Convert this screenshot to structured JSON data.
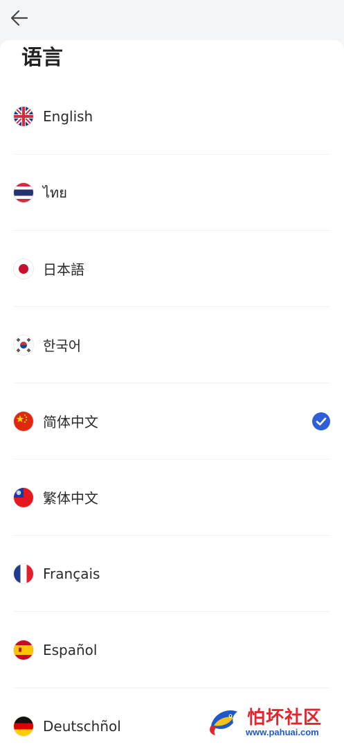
{
  "header": {
    "back_icon": "arrow-left-icon"
  },
  "page": {
    "title": "语言"
  },
  "languages": [
    {
      "label": "English",
      "flag": "uk-flag-icon",
      "selected": false
    },
    {
      "label": "ไทย",
      "flag": "thailand-flag-icon",
      "selected": false
    },
    {
      "label": "日本語",
      "flag": "japan-flag-icon",
      "selected": false
    },
    {
      "label": "한국어",
      "flag": "korea-flag-icon",
      "selected": false
    },
    {
      "label": "简体中文",
      "flag": "china-flag-icon",
      "selected": true
    },
    {
      "label": "繁体中文",
      "flag": "taiwan-flag-icon",
      "selected": false
    },
    {
      "label": "Français",
      "flag": "france-flag-icon",
      "selected": false
    },
    {
      "label": "Español",
      "flag": "spain-flag-icon",
      "selected": false
    },
    {
      "label": "Deutschñol",
      "flag": "germany-flag-icon",
      "selected": false
    }
  ],
  "watermark": {
    "title": "怕坏社区",
    "url": "www.pahuai.com"
  },
  "colors": {
    "accent": "#2f5fd8",
    "background": "#f3f5f6",
    "divider": "#eef0f2"
  }
}
